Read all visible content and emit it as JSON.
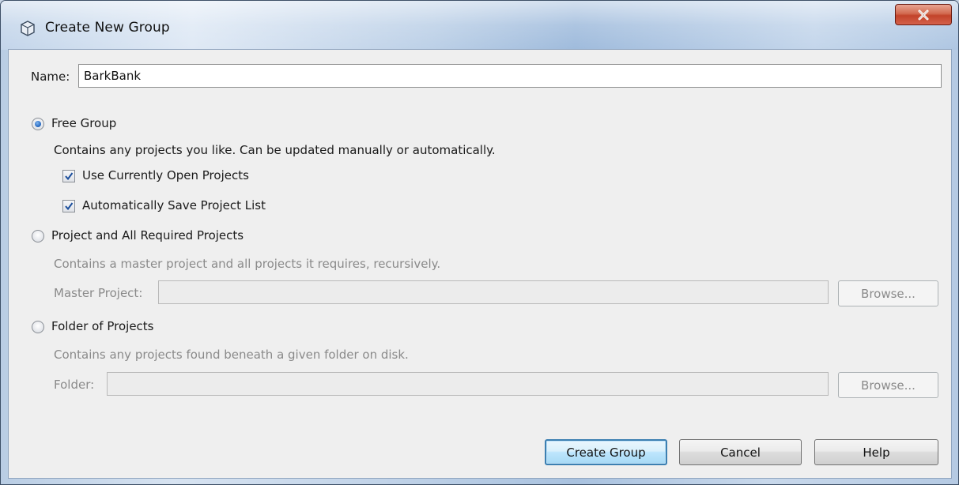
{
  "window": {
    "title": "Create New Group",
    "close_label": "X"
  },
  "name_field": {
    "label": "Name:",
    "value": "BarkBank"
  },
  "free_group": {
    "label": "Free Group",
    "selected": true,
    "description": "Contains any projects you like. Can be updated manually or automatically.",
    "use_open_projects": {
      "label": "Use Currently Open Projects",
      "checked": true
    },
    "auto_save_list": {
      "label": "Automatically Save Project List",
      "checked": true
    }
  },
  "required_projects": {
    "label": "Project and All Required Projects",
    "selected": false,
    "description": "Contains a master project and all projects it requires, recursively.",
    "master_label": "Master Project:",
    "master_value": "",
    "browse_label": "Browse..."
  },
  "folder_projects": {
    "label": "Folder of Projects",
    "selected": false,
    "description": "Contains any projects found beneath a given folder on disk.",
    "folder_label": "Folder:",
    "folder_value": "",
    "browse_label": "Browse..."
  },
  "buttons": {
    "create": "Create Group",
    "cancel": "Cancel",
    "help": "Help"
  },
  "colors": {
    "default_button_border": "#3c7fb1",
    "close_button": "#c2432a",
    "radio_selected": "#2c6ec4",
    "disabled_text": "#8a8a8a"
  }
}
